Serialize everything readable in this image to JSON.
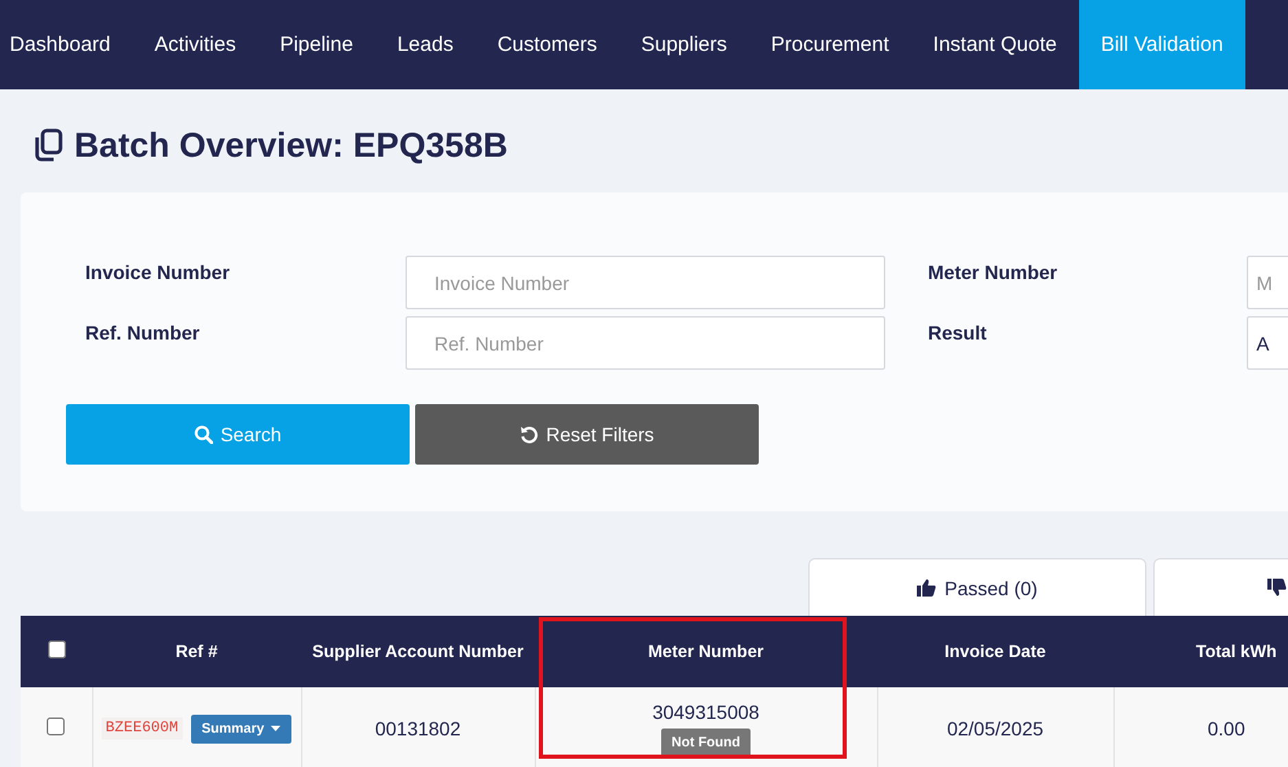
{
  "nav": [
    {
      "label": "Dashboard",
      "selected": false
    },
    {
      "label": "Activities",
      "selected": false
    },
    {
      "label": "Pipeline",
      "selected": false
    },
    {
      "label": "Leads",
      "selected": false
    },
    {
      "label": "Customers",
      "selected": false
    },
    {
      "label": "Suppliers",
      "selected": false
    },
    {
      "label": "Procurement",
      "selected": false
    },
    {
      "label": "Instant Quote",
      "selected": false
    },
    {
      "label": "Bill Validation",
      "selected": true
    }
  ],
  "page_title": "Batch Overview: EPQ358B",
  "filters": {
    "fields": [
      {
        "label": "Invoice Number",
        "placeholder": "Invoice Number"
      },
      {
        "label": "Meter Number",
        "placeholder": "M"
      },
      {
        "label": "Ref. Number",
        "placeholder": "Ref. Number"
      },
      {
        "label": "Result",
        "value": "A"
      }
    ],
    "buttons": [
      {
        "label": "Search",
        "kind": "search"
      },
      {
        "label": "Reset Filters",
        "kind": "reset"
      }
    ]
  },
  "result_tabs": [
    {
      "label": "Passed (0)",
      "kind": "passed",
      "selected": false
    },
    {
      "kind": "failed",
      "selected": false
    }
  ],
  "table": {
    "select_all": {
      "checked": false
    },
    "columns": [
      {
        "label": "Ref #",
        "highlighted": false
      },
      {
        "label": "Supplier Account Number",
        "highlighted": false
      },
      {
        "label": "Meter Number",
        "highlighted": true
      },
      {
        "label": "Invoice Date",
        "highlighted": false
      },
      {
        "label": "Total kWh",
        "highlighted": false
      }
    ],
    "rows": [
      {
        "checked": false,
        "ref": "BZEE600M",
        "action": "Summary",
        "supplier_account": "00131802",
        "meter_number": "3049315008",
        "meter_status": "Not Found",
        "invoice_date": "02/05/2025",
        "total_kwh": "0.00"
      }
    ]
  }
}
